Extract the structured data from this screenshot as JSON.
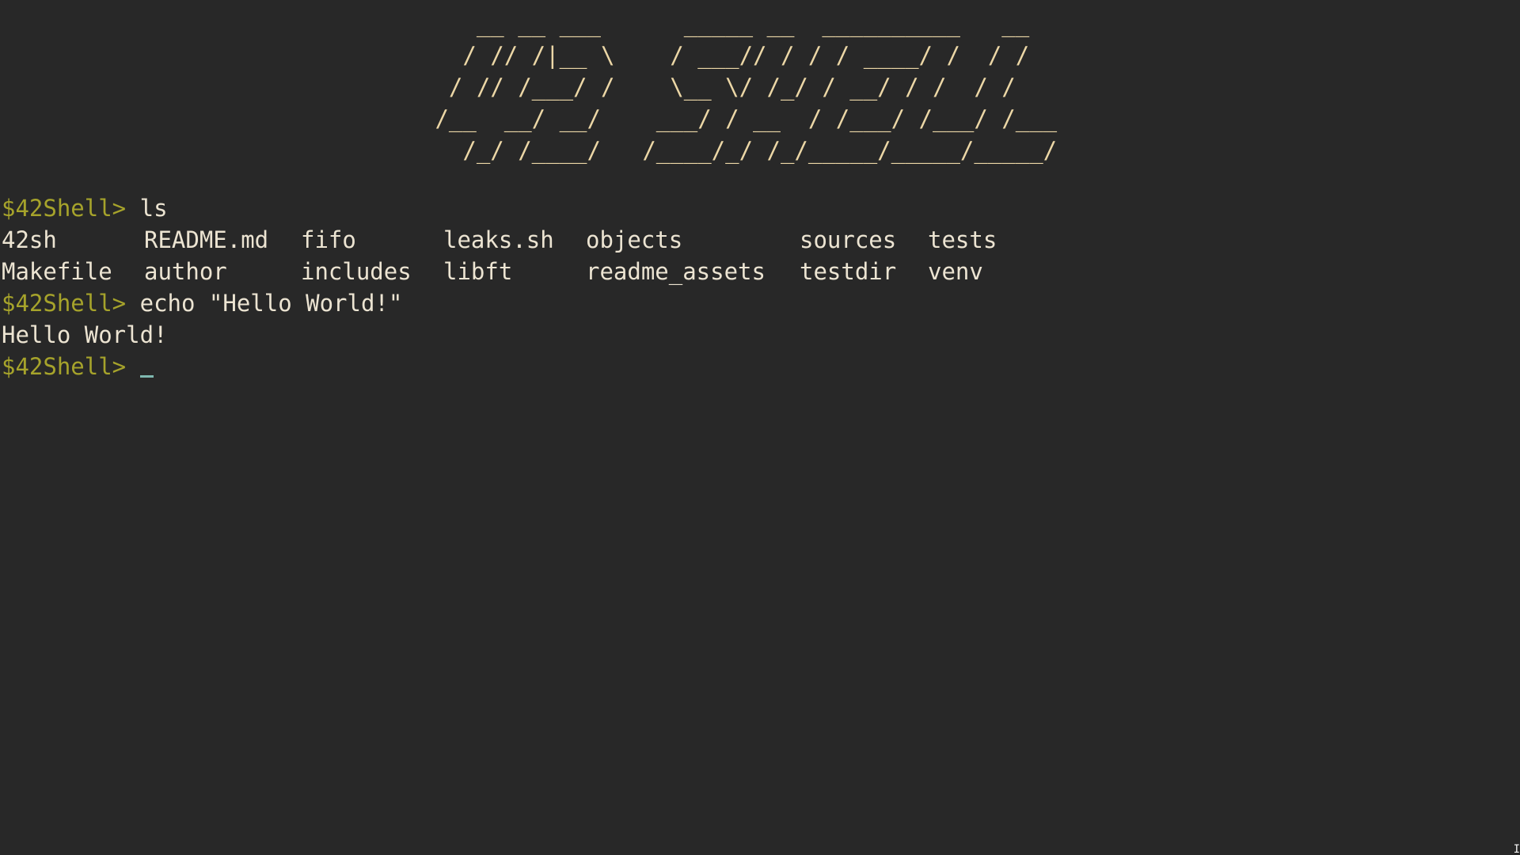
{
  "banner": {
    "lines": [
      "    __ __ ___      _____ __  __________   __",
      "   / // /|__ \\    / ___// / / / ____/ /  / /",
      "  / // /___/ /    \\__ \\/ /_/ / __/ / /  / /",
      " /__  __/ __/    ___/ / __  / /___/ /___/ /___",
      "   /_/ /____/   /____/_/ /_/_____/_____/_____/"
    ]
  },
  "session": {
    "prompt": "$42Shell>",
    "command1": "ls",
    "ls_output": [
      [
        "42sh",
        "README.md",
        "fifo",
        "leaks.sh",
        "objects",
        "sources",
        "tests"
      ],
      [
        "Makefile",
        "author",
        "includes",
        "libft",
        "readme_assets",
        "testdir",
        "venv"
      ]
    ],
    "command2": "echo \"Hello World!\"",
    "output2": "Hello World!",
    "cursor": "_"
  },
  "colors": {
    "background": "#282828",
    "prompt": "#a6a32b",
    "text": "#ece4d2",
    "banner": "#ecd7a6",
    "cursor": "#7fb8b0"
  },
  "icons": {
    "resize_grip": "text-cursor-icon"
  }
}
